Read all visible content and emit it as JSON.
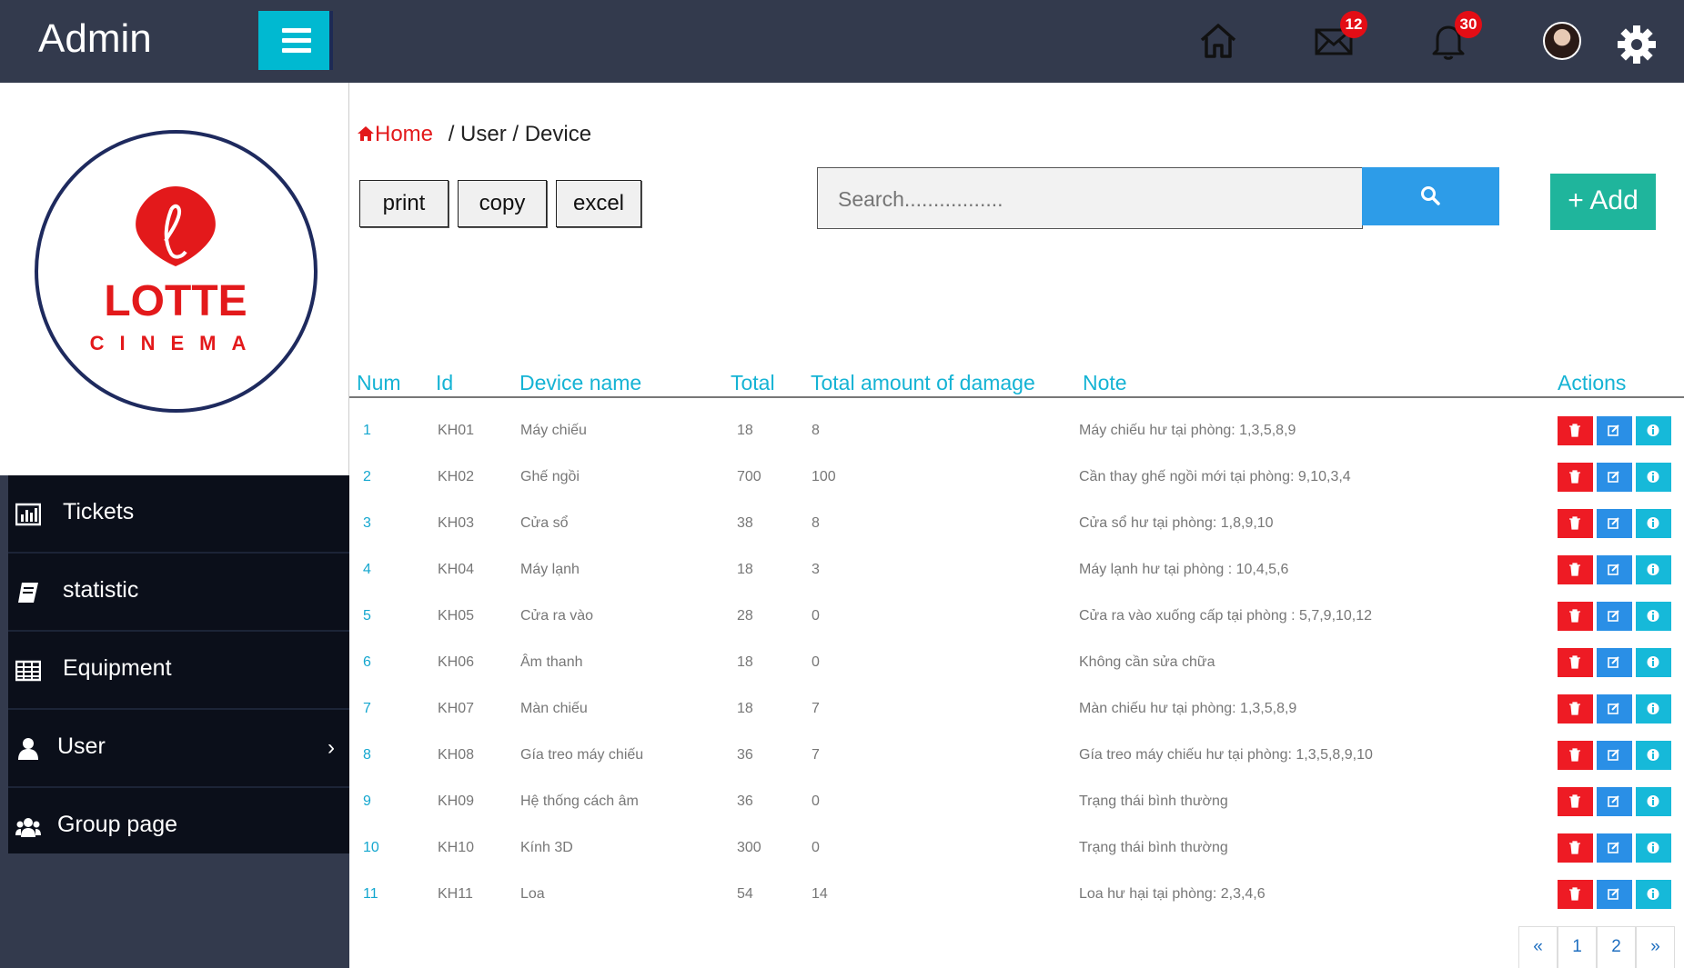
{
  "header": {
    "brand": "Admin",
    "mail_count": "12",
    "notification_count": "30"
  },
  "logo": {
    "name": "LOTTE",
    "sub": "CINEMA"
  },
  "sidebar": {
    "items": [
      {
        "label": "Tickets",
        "icon": "bar-chart-icon"
      },
      {
        "label": "statistic",
        "icon": "book-icon"
      },
      {
        "label": "Equipment",
        "icon": "table-icon"
      },
      {
        "label": "User",
        "icon": "user-icon"
      },
      {
        "label": "Group page",
        "icon": "users-icon"
      }
    ]
  },
  "breadcrumb": {
    "home": "Home",
    "rest": " / User / Device"
  },
  "toolbar": {
    "print": "print",
    "copy": "copy",
    "excel": "excel",
    "add": "+ Add"
  },
  "search": {
    "placeholder": "Search................."
  },
  "table": {
    "headers": [
      "Num",
      "Id",
      "Device name",
      "Total",
      "Total amount of damage",
      "Note",
      "Actions"
    ],
    "rows": [
      {
        "num": "1",
        "id": "KH01",
        "name": "Máy chiếu",
        "total": "18",
        "damage": "8",
        "note": "Máy chiếu hư tại phòng: 1,3,5,8,9"
      },
      {
        "num": "2",
        "id": "KH02",
        "name": "Ghế ngồi",
        "total": "700",
        "damage": "100",
        "note": "Cần thay ghế ngồi mới tại phòng: 9,10,3,4"
      },
      {
        "num": "3",
        "id": "KH03",
        "name": "Cửa sổ",
        "total": "38",
        "damage": "8",
        "note": "Cửa sổ hư tại phòng: 1,8,9,10"
      },
      {
        "num": "4",
        "id": "KH04",
        "name": "Máy lạnh",
        "total": "18",
        "damage": "3",
        "note": "Máy lạnh hư tại phòng : 10,4,5,6"
      },
      {
        "num": "5",
        "id": "KH05",
        "name": "Cửa ra vào",
        "total": "28",
        "damage": "0",
        "note": "Cửa ra vào xuống cấp tại phòng : 5,7,9,10,12"
      },
      {
        "num": "6",
        "id": "KH06",
        "name": "Âm thanh",
        "total": "18",
        "damage": "0",
        "note": "Không cần sửa chữa"
      },
      {
        "num": "7",
        "id": "KH07",
        "name": "Màn chiếu",
        "total": "18",
        "damage": "7",
        "note": "Màn chiếu hư tại phòng: 1,3,5,8,9"
      },
      {
        "num": "8",
        "id": "KH08",
        "name": "Gía treo máy chiếu",
        "total": "36",
        "damage": "7",
        "note": "Gía treo máy chiếu hư tại phòng: 1,3,5,8,9,10"
      },
      {
        "num": "9",
        "id": "KH09",
        "name": "Hệ thống cách âm",
        "total": "36",
        "damage": "0",
        "note": "Trạng thái bình thường"
      },
      {
        "num": "10",
        "id": "KH10",
        "name": "Kính 3D",
        "total": "300",
        "damage": "0",
        "note": "Trạng thái bình thường"
      },
      {
        "num": "11",
        "id": "KH11",
        "name": "Loa",
        "total": "54",
        "damage": "14",
        "note": "Loa hư hại tại phòng: 2,3,4,6"
      }
    ]
  },
  "pagination": {
    "prev": "«",
    "pages": [
      "1",
      "2"
    ],
    "next": "»"
  },
  "colors": {
    "topbar": "#333a4d",
    "accent": "#00b9d1",
    "header_text": "#15b3d4",
    "delete": "#ee1b24",
    "edit": "#2a8fe6",
    "info": "#16b9d9",
    "add": "#1fb59c",
    "logo_red": "#e3191b"
  }
}
